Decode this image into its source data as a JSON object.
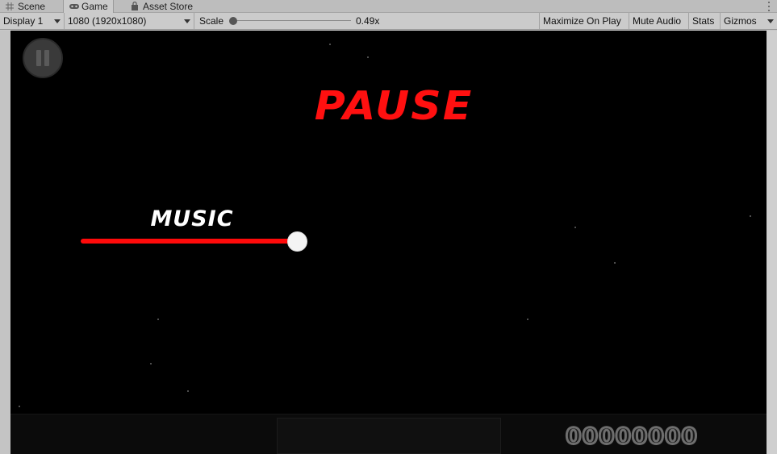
{
  "tabs": [
    {
      "label": "Scene",
      "icon": "grid-icon"
    },
    {
      "label": "Game",
      "icon": "gamepad-icon",
      "active": true
    },
    {
      "label": "Asset Store",
      "icon": "bag-icon"
    }
  ],
  "toolbar": {
    "display": "Display 1",
    "resolution": "1080 (1920x1080)",
    "scale_label": "Scale",
    "scale_value": "0.49x",
    "maximize_on_play": "Maximize On Play",
    "mute_audio": "Mute Audio",
    "stats": "Stats",
    "gizmos": "Gizmos"
  },
  "game": {
    "title": "PAUSE",
    "music_label": "MUSIC",
    "music_volume": 1.0,
    "score": "00000000"
  },
  "colors": {
    "accent_red": "#ff1010",
    "background": "#000000",
    "knob": "#f4f4f4"
  }
}
